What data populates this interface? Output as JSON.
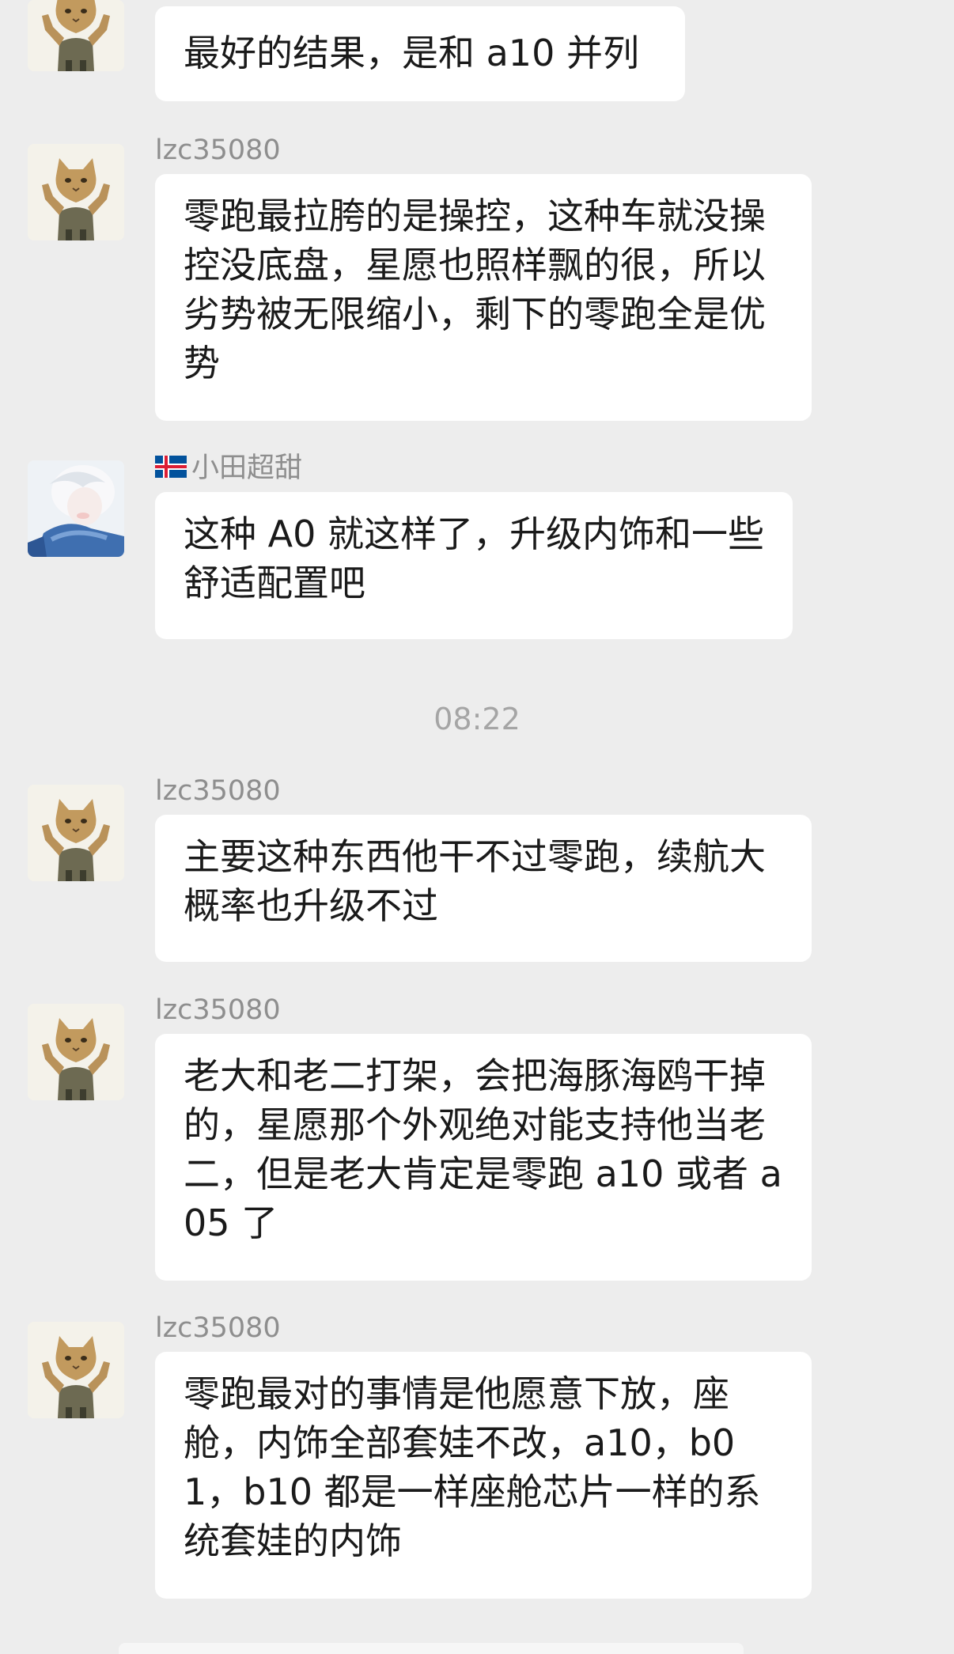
{
  "messages": [
    {
      "sender": "",
      "text": "最好的结果，是和 a10 并列"
    },
    {
      "sender": "lzc35080",
      "text": "零跑最拉胯的是操控，这种车就没操控没底盘，星愿也照样飘的很，所以劣势被无限缩小，剩下的零跑全是优势"
    },
    {
      "sender": "小田超甜",
      "text": "这种 A0 就这样了，升级内饰和一些舒适配置吧"
    },
    {
      "sender": "lzc35080",
      "text": "主要这种东西他干不过零跑，续航大概率也升级不过"
    },
    {
      "sender": "lzc35080",
      "text": "老大和老二打架，会把海豚海鸥干掉的，星愿那个外观绝对能支持他当老二，但是老大肯定是零跑 a10 或者 a05 了"
    },
    {
      "sender": "lzc35080",
      "text": "零跑最对的事情是他愿意下放，座舱，内饰全部套娃不改，a10，b01，b10 都是一样座舱芯片一样的系统套娃的内饰"
    }
  ],
  "timestamp": "08:22",
  "colors": {
    "background": "#ededed",
    "bubble": "#ffffff",
    "sender_name": "#8e8e8e",
    "timestamp": "#a5a5a5",
    "text": "#1a1a1a"
  },
  "icons": {
    "cat_avatar": "cat-avatar-icon",
    "anime_avatar": "anime-avatar-icon",
    "flag": "iceland-flag-icon"
  }
}
